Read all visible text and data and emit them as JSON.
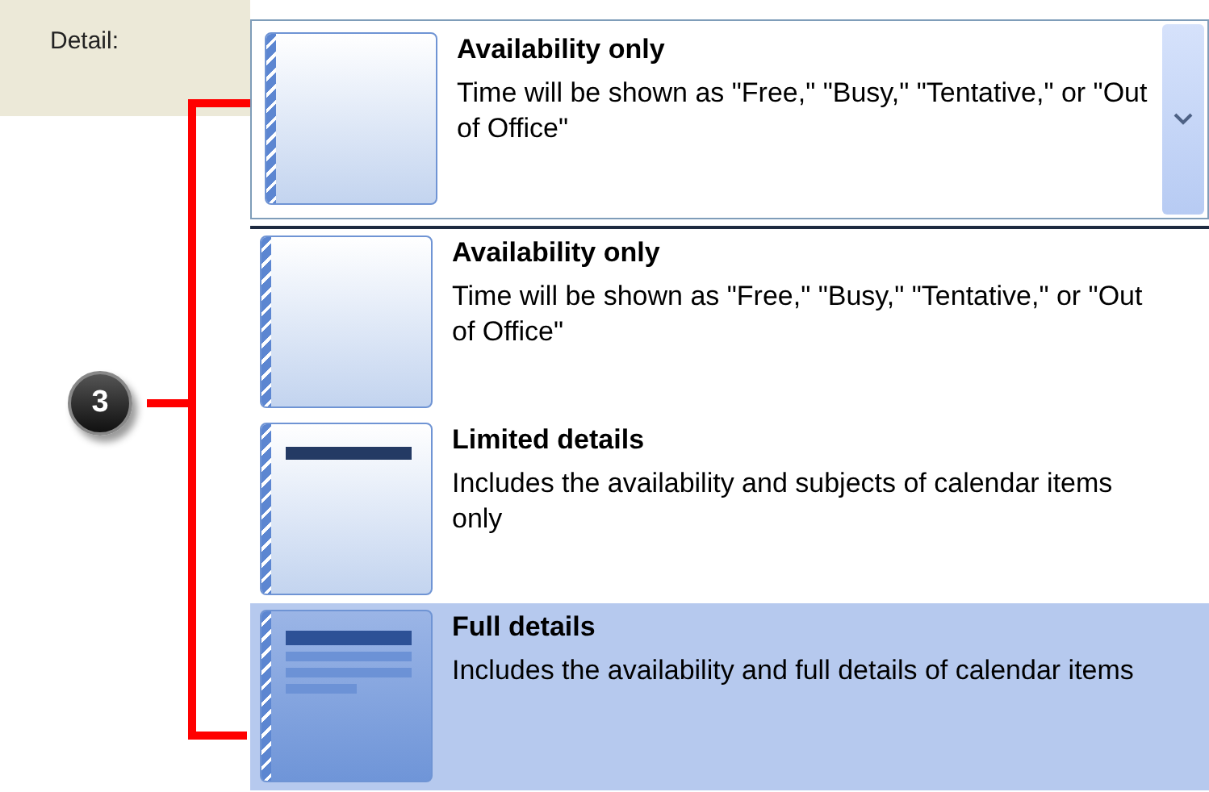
{
  "field": {
    "label": "Detail:",
    "value": {
      "kind": "blank",
      "title": "Availability only",
      "description": "Time will be shown as \"Free,\" \"Busy,\" \"Tentative,\" or \"Out of Office\""
    }
  },
  "options": [
    {
      "kind": "blank",
      "title": "Availability only",
      "description": "Time will be shown as \"Free,\" \"Busy,\" \"Tentative,\" or \"Out of Office\"",
      "selected": false
    },
    {
      "kind": "limited",
      "title": "Limited details",
      "description": "Includes the availability and subjects of calendar items only",
      "selected": false
    },
    {
      "kind": "full",
      "title": "Full details",
      "description": "Includes the availability and full details of calendar items",
      "selected": true
    }
  ],
  "callout": {
    "number": "3"
  }
}
